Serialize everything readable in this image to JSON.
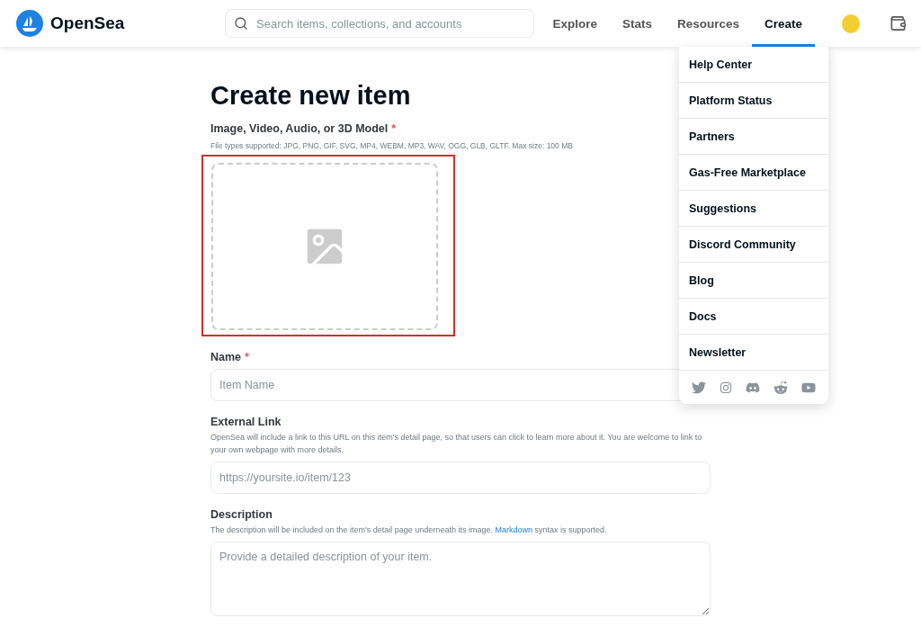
{
  "header": {
    "brand": "OpenSea",
    "search": {
      "placeholder": "Search items, collections, and accounts"
    },
    "nav": [
      {
        "label": "Explore",
        "selected": false
      },
      {
        "label": "Stats",
        "selected": false
      },
      {
        "label": "Resources",
        "selected": false
      },
      {
        "label": "Create",
        "selected": true
      }
    ]
  },
  "menu": {
    "items": [
      "Help Center",
      "Platform Status",
      "Partners",
      "Gas-Free Marketplace",
      "Suggestions",
      "Discord Community",
      "Blog",
      "Docs",
      "Newsletter"
    ]
  },
  "page": {
    "title": "Create new item",
    "media": {
      "label": "Image, Video, Audio, or 3D Model",
      "required_mark": "*",
      "hint": "File types supported: JPG, PNG, GIF, SVG, MP4, WEBM, MP3, WAV, OGG, GLB, GLTF. Max size: 100 MB",
      "highlighted": true
    },
    "fields": [
      {
        "kind": "input",
        "label": "Name",
        "required_mark": "*",
        "placeholder": "Item Name"
      },
      {
        "kind": "input",
        "label": "External Link",
        "help": {
          "before": "OpenSea will include a link to this URL on this item's detail page, so that users can click to learn more about it. You are welcome to link to your own webpage with more details."
        },
        "placeholder": "https://yoursite.io/item/123"
      },
      {
        "kind": "textarea",
        "label": "Description",
        "help": {
          "before": "The description will be included on the item's detail page underneath its image.",
          "link": "Markdown",
          "after": "syntax is supported."
        },
        "placeholder": "Provide a detailed description of your item."
      }
    ]
  }
}
